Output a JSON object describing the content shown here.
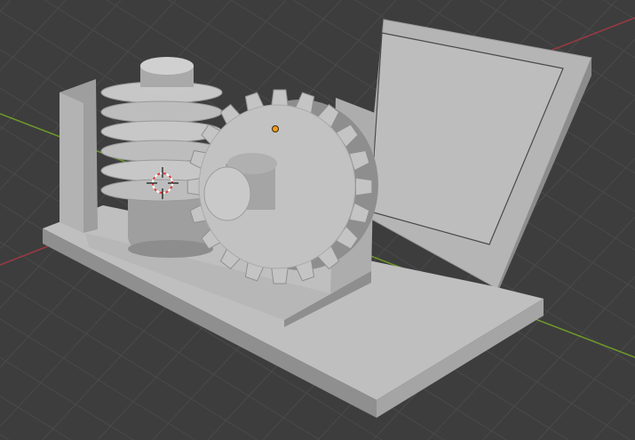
{
  "app": {
    "name": "3D Viewport"
  },
  "viewport": {
    "background_color": "#3d3d3d",
    "grid_color": "#4a4a4a",
    "x_axis_color": "#9b3a43",
    "y_axis_color": "#6f9a2a",
    "model_base_color": "#b8b8b8",
    "model_shadow_color": "#8a8a8a",
    "model_light_color": "#cfcfcf",
    "origin_color": "#f29b1d"
  },
  "scene": {
    "objects": [
      {
        "name": "mounting-plate",
        "kind": "L-bracket"
      },
      {
        "name": "worm-gear",
        "kind": "threaded cylinder"
      },
      {
        "name": "spur-gear",
        "kind": "toothed wheel",
        "teeth": 20
      },
      {
        "name": "back-panel",
        "kind": "inclined plate"
      }
    ],
    "icons": [
      "3d-cursor-icon",
      "object-origin-icon"
    ]
  }
}
